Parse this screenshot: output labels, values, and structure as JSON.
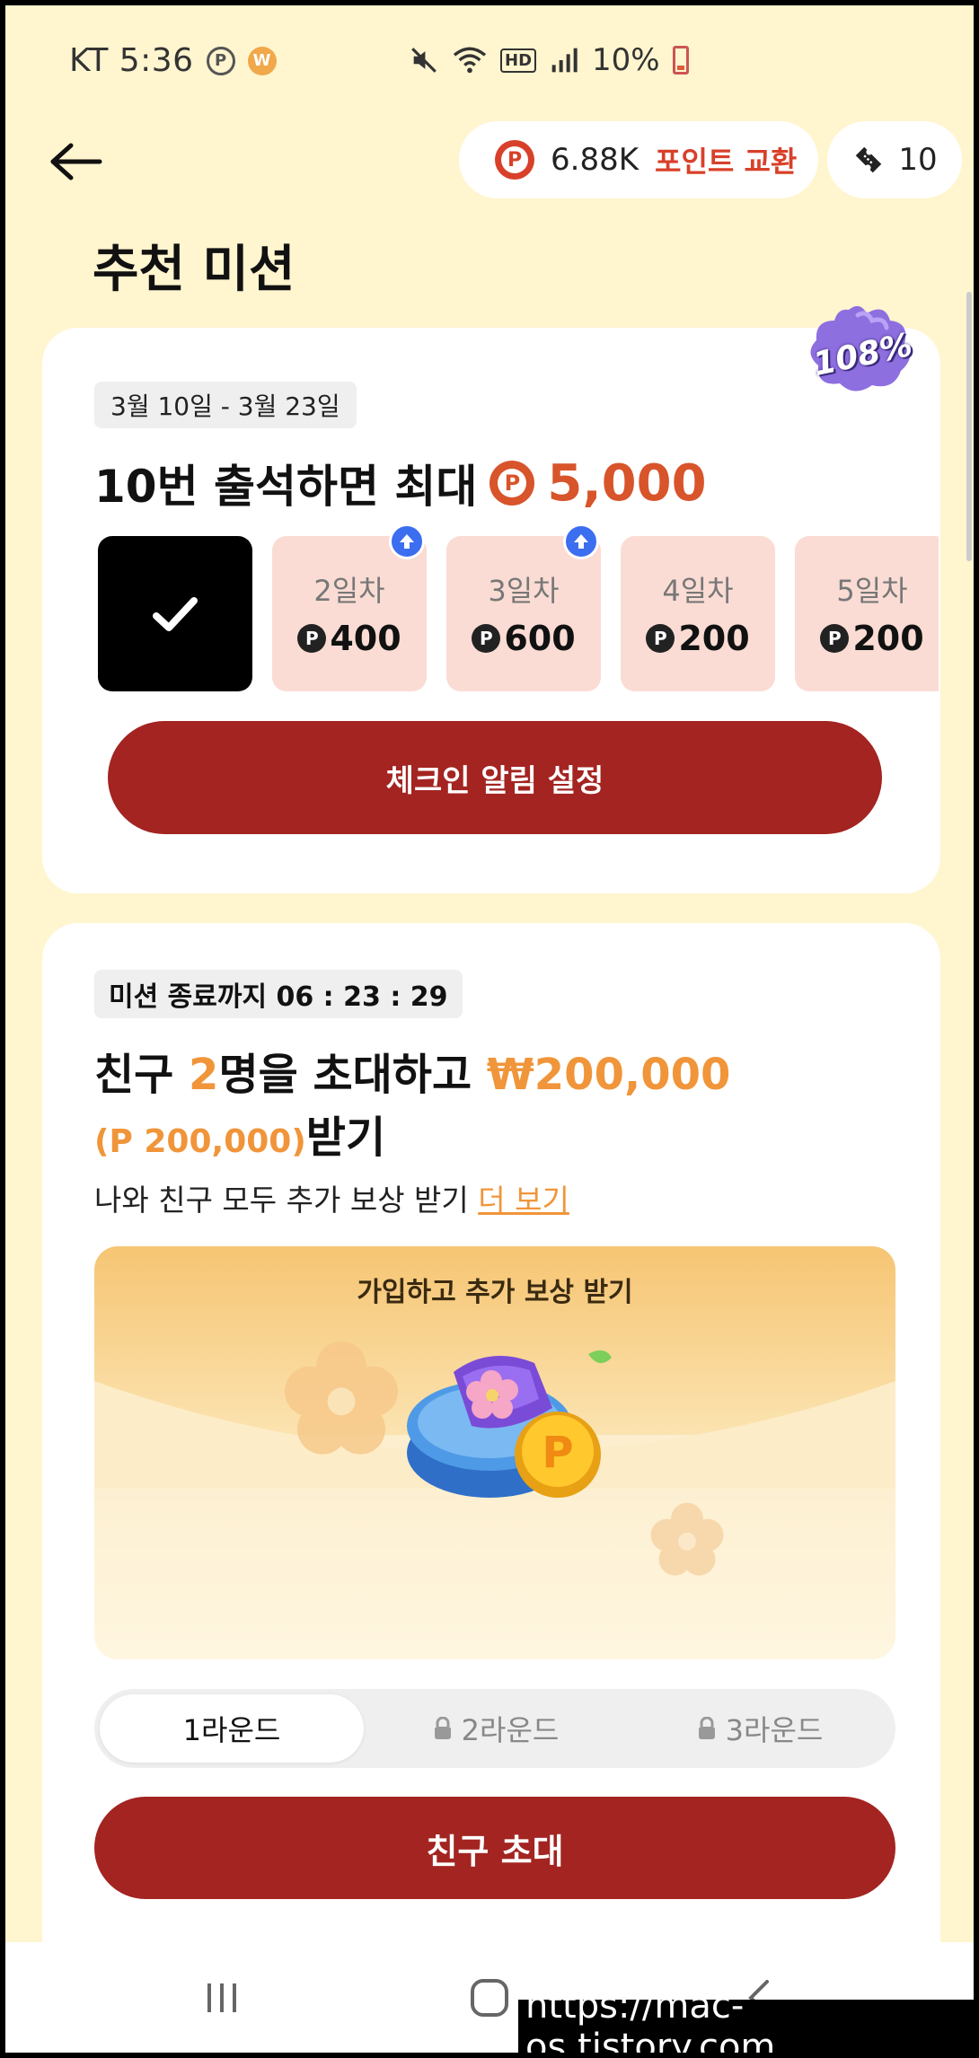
{
  "status_bar": {
    "carrier_time": "KT 5:36",
    "app_icon_p": "P",
    "app_icon_w": "W",
    "icons": [
      "mute-icon",
      "wifi-icon",
      "hd-icon",
      "signal-icon"
    ],
    "hd_label": "HD",
    "battery": "10%"
  },
  "header": {
    "points_amount": "6.88K",
    "points_exchange": "포인트 교환",
    "points_coin": "P",
    "ticket_count": "10"
  },
  "page_title": "추천 미션",
  "attendance_card": {
    "badge": "108%",
    "date_range": "3월 10일 - 3월 23일",
    "headline": "10번 출석하면 최대",
    "coin_symbol": "P",
    "max_amount": "5,000",
    "days": [
      {
        "label": "",
        "amount": "",
        "done": true,
        "boosted": false
      },
      {
        "label": "2일차",
        "amount": "400",
        "done": false,
        "boosted": true
      },
      {
        "label": "3일차",
        "amount": "600",
        "done": false,
        "boosted": true
      },
      {
        "label": "4일차",
        "amount": "200",
        "done": false,
        "boosted": false
      },
      {
        "label": "5일차",
        "amount": "200",
        "done": false,
        "boosted": false
      }
    ],
    "checkin_button": "체크인 알림 설정"
  },
  "invite_card": {
    "timer": "미션 종료까지 06 : 23 : 29",
    "line1_a": "친구 ",
    "line1_num": "2",
    "line1_b": "명을 초대하고 ",
    "line1_amount": "₩200,000",
    "line2_sub": "(P 200,000)",
    "line2_main": "받기",
    "desc": "나와 친구 모두 추가 보상 받기 ",
    "more_link": "더 보기",
    "reward_title": "가입하고 추가 보상 받기",
    "round_tabs": [
      {
        "label": "1라운드",
        "locked": false,
        "active": true
      },
      {
        "label": "2라운드",
        "locked": true,
        "active": false
      },
      {
        "label": "3라운드",
        "locked": true,
        "active": false
      }
    ],
    "invite_button": "친구 초대"
  },
  "nav_bar": {
    "icons": [
      "recent-apps-icon",
      "home-icon",
      "back-nav-icon"
    ]
  },
  "watermark": "https://mac-os.tistory.com",
  "colors": {
    "background": "#fff5cf",
    "primary_red": "#a32421",
    "accent_orange": "#f0953a",
    "coin_red": "#d8542a",
    "day_pending_bg": "#fadcd4",
    "boost_blue": "#3c6ef0"
  }
}
